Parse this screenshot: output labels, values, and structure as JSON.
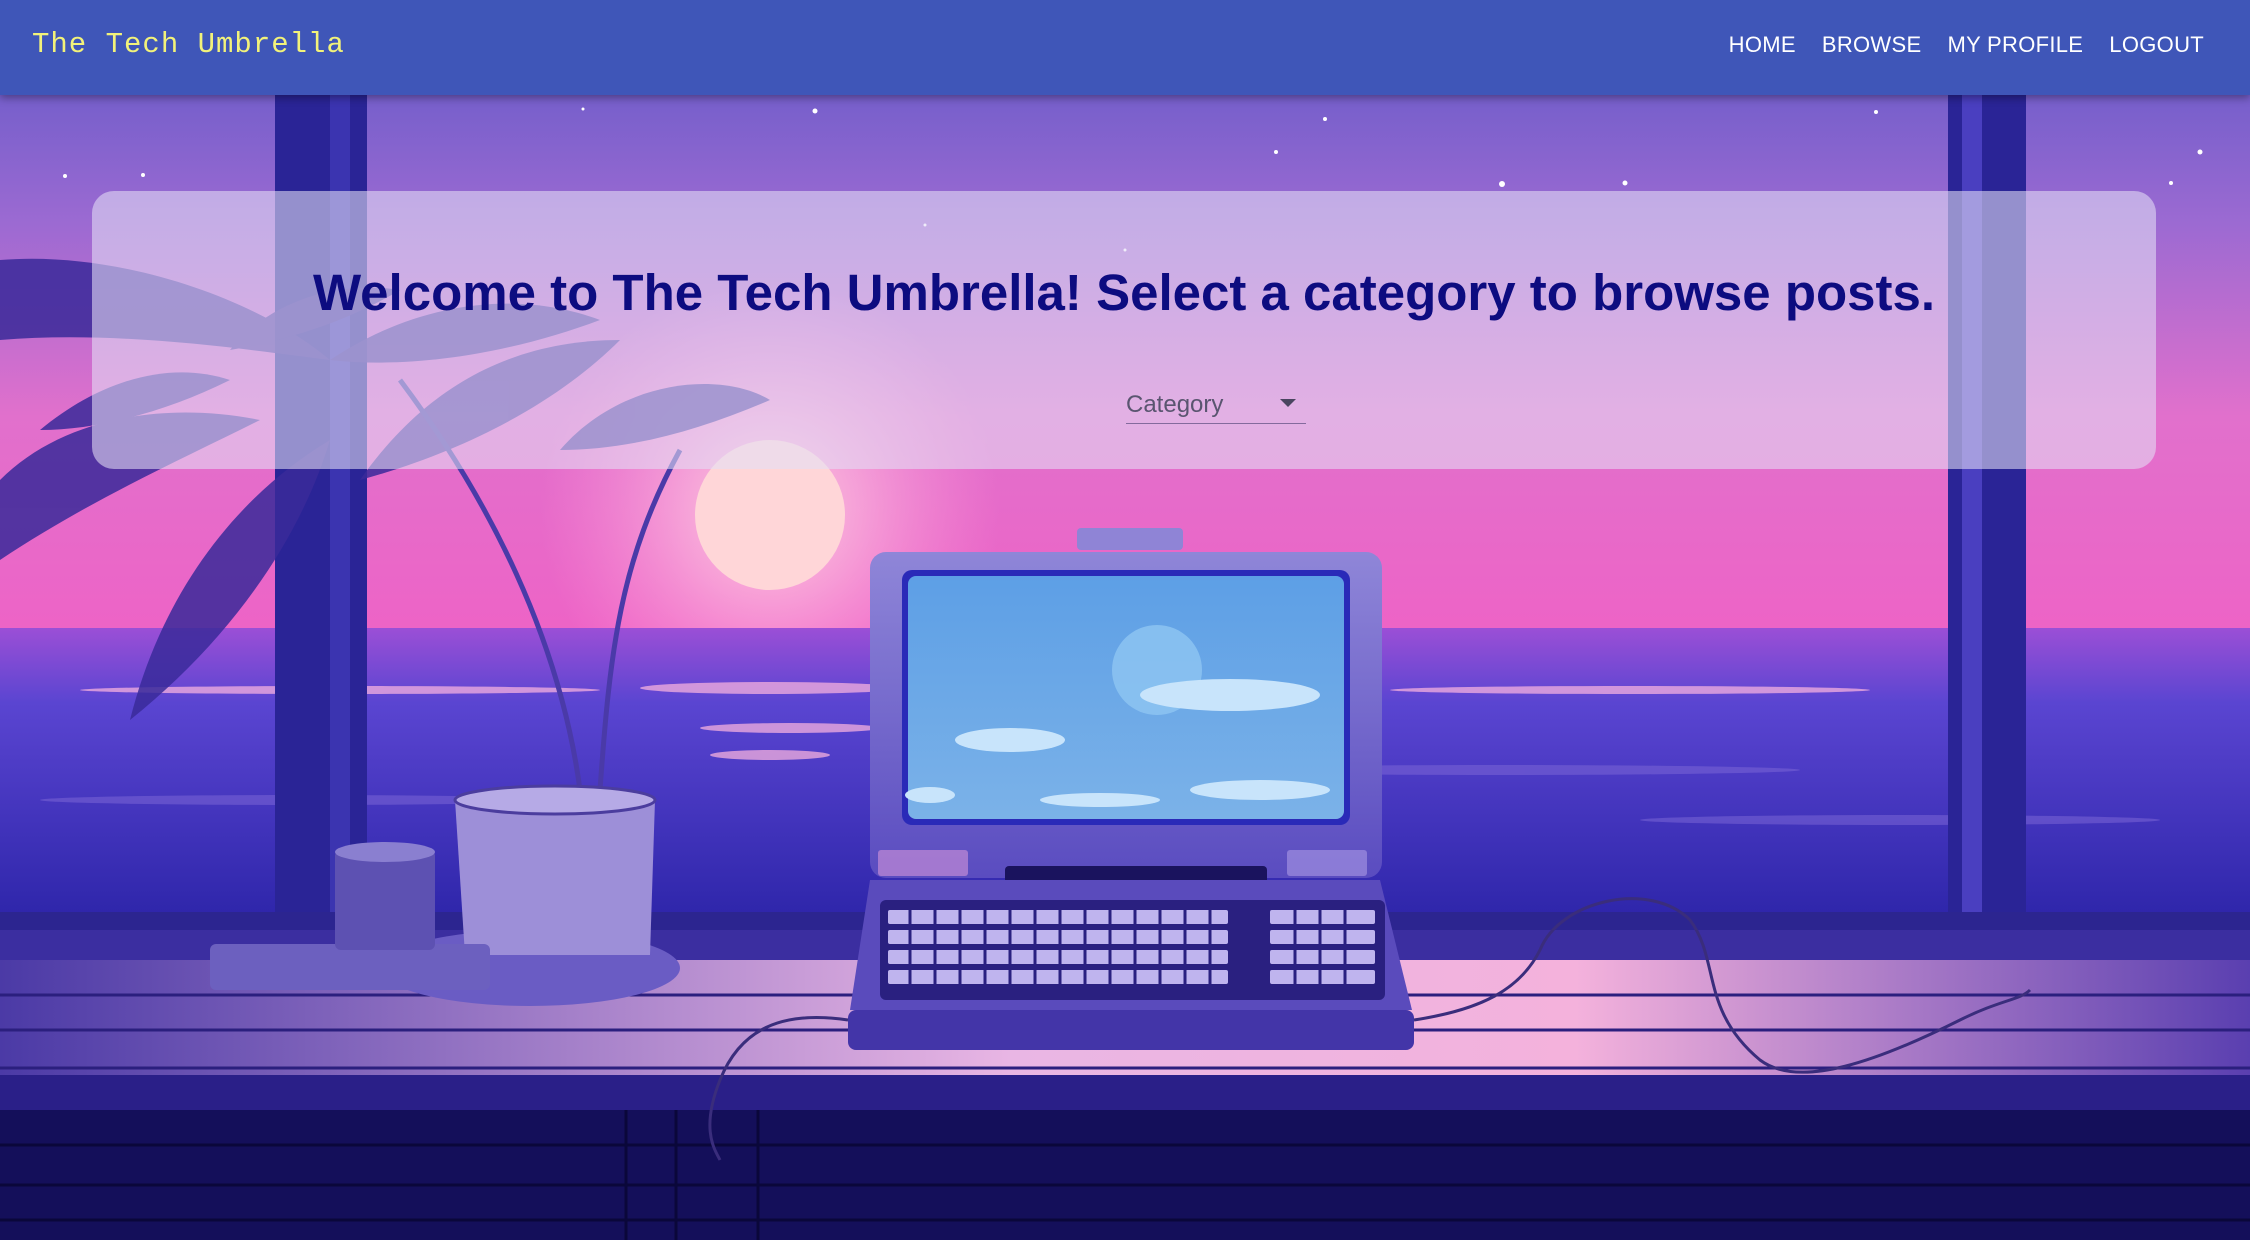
{
  "navbar": {
    "brand": "The Tech Umbrella",
    "links": [
      "HOME",
      "BROWSE",
      "MY PROFILE",
      "LOGOUT"
    ]
  },
  "hero": {
    "title": "Welcome to The Tech Umbrella! Select a category to browse posts.",
    "category_select": {
      "placeholder": "Category"
    }
  },
  "colors": {
    "navbar_bg": "#3f56b8",
    "brand_text": "#f2f27a",
    "title_text": "#0d0c80"
  }
}
